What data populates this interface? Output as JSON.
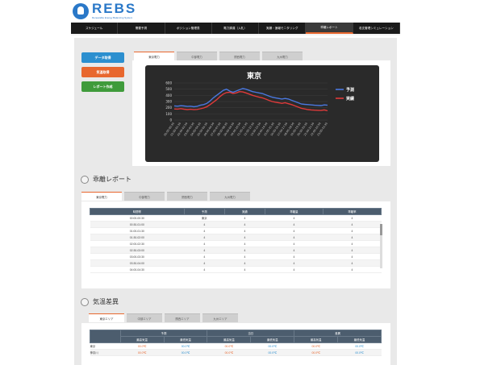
{
  "brand": {
    "name": "REBS",
    "tagline": "Renewable Energy Balancing System"
  },
  "nav": [
    "スケジュール",
    "需要予測",
    "ポジション管理表",
    "電力調達（入札）",
    "実績・速報モニタリング",
    "乖離レポート",
    "収支管理シミュレーション"
  ],
  "nav_active_index": 5,
  "side_buttons": {
    "data": "データ取得",
    "weather": "気温取得",
    "report": "レポート作成"
  },
  "area_tabs": [
    "東京電力",
    "中部電力",
    "関西電力",
    "九州電力"
  ],
  "chart_data": {
    "type": "line",
    "title": "東京",
    "ylim": [
      0,
      600
    ],
    "yticks": [
      0,
      100,
      200,
      300,
      400,
      500,
      600
    ],
    "x": [
      "00:00-00:30",
      "01:00-01:30",
      "02:00-02:30",
      "03:00-03:30",
      "04:00-04:30",
      "05:00-05:30",
      "06:00-06:30",
      "07:00-07:30",
      "08:00-08:30",
      "09:00-09:30",
      "10:00-10:30",
      "11:00-11:30",
      "12:00-12:30",
      "13:00-13:30",
      "14:00-14:30",
      "15:00-15:30",
      "16:00-16:30",
      "17:00-17:30",
      "18:00-18:30",
      "19:00-19:30",
      "20:00-20:30",
      "21:00-21:30",
      "22:00-22:30",
      "23:00-23:30"
    ],
    "series": [
      {
        "name": "予測",
        "color": "#4a78e0",
        "values": [
          230,
          225,
          232,
          228,
          220,
          225,
          215,
          222,
          240,
          250,
          270,
          310,
          360,
          400,
          440,
          480,
          500,
          470,
          450,
          470,
          490,
          510,
          500,
          480,
          460,
          450,
          440,
          430,
          410,
          390,
          370,
          360,
          350,
          340,
          350,
          340,
          320,
          300,
          280,
          260,
          255,
          250,
          245,
          240,
          238,
          235,
          245,
          240
        ]
      },
      {
        "name": "実績",
        "color": "#e03a3a",
        "values": [
          180,
          178,
          185,
          176,
          170,
          175,
          168,
          172,
          182,
          195,
          215,
          250,
          290,
          330,
          380,
          420,
          445,
          450,
          430,
          440,
          460,
          455,
          440,
          420,
          400,
          385,
          370,
          360,
          340,
          320,
          300,
          290,
          280,
          270,
          280,
          265,
          250,
          230,
          210,
          190,
          180,
          170,
          165,
          160,
          158,
          155,
          165,
          150
        ]
      }
    ]
  },
  "report_section": {
    "title": "乖離レポート",
    "tabs": [
      "東京電力",
      "中部電力",
      "関西電力",
      "九州電力"
    ],
    "columns": [
      "時間帯",
      "予測",
      "実績",
      "乖離量",
      "乖離率"
    ],
    "rows": [
      [
        "00:00-00:30",
        "東京",
        "4",
        "4",
        "4"
      ],
      [
        "00:30-01:00",
        "4",
        "4",
        "4",
        "4"
      ],
      [
        "01:00-01:30",
        "4",
        "4",
        "4",
        "4"
      ],
      [
        "01:30-02:00",
        "4",
        "4",
        "4",
        "4"
      ],
      [
        "02:00-02:30",
        "4",
        "4",
        "4",
        "4"
      ],
      [
        "02:30-03:00",
        "4",
        "4",
        "4",
        "4"
      ],
      [
        "03:00-03:30",
        "4",
        "4",
        "4",
        "4"
      ],
      [
        "03:30-04:00",
        "4",
        "4",
        "4",
        "4"
      ],
      [
        "04:00-04:30",
        "4",
        "4",
        "4",
        "4"
      ]
    ]
  },
  "weather_section": {
    "title": "気温差異",
    "tabs": [
      "東京エリア",
      "中部エリア",
      "関西エリア",
      "九州エリア"
    ],
    "groups": [
      "予測",
      "当日",
      "差異"
    ],
    "subcolumns": [
      "最高気温",
      "最低気温"
    ],
    "rows": [
      {
        "area": "東京",
        "values": [
          "00.0℃",
          "00.0℃",
          "00.0℃",
          "00.0℃",
          "00.0℃",
          "00.0℃"
        ]
      },
      {
        "area": "神奈川",
        "values": [
          "00.0℃",
          "00.0℃",
          "00.0℃",
          "00.0℃",
          "00.0℃",
          "00.0℃"
        ]
      }
    ]
  }
}
